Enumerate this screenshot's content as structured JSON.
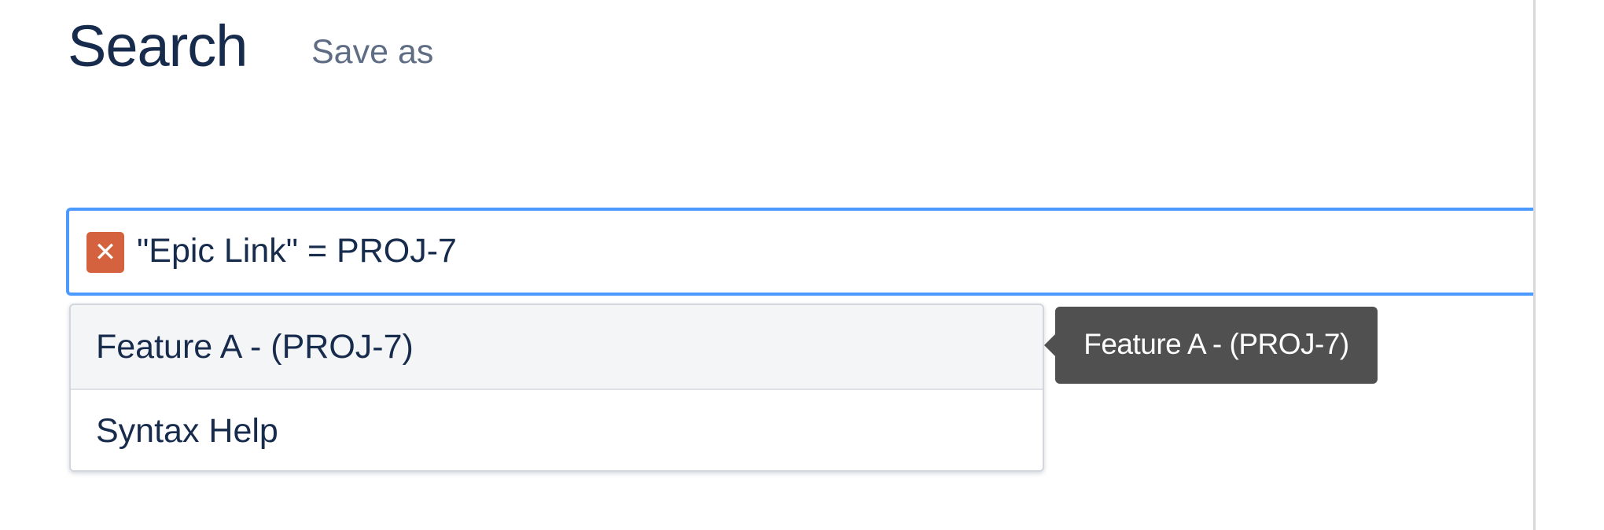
{
  "header": {
    "title": "Search",
    "save_as_label": "Save as"
  },
  "search": {
    "query": "\"Epic Link\" = PROJ-7",
    "error_icon": "close-x-icon",
    "error_icon_glyph": "✕"
  },
  "suggestions": {
    "items": [
      {
        "label": "Feature A - (PROJ-7)"
      },
      {
        "label": "Syntax Help"
      }
    ]
  },
  "tooltip": {
    "text": "Feature A - (PROJ-7)"
  },
  "colors": {
    "title": "#172b4d",
    "focus_border": "#4c9aff",
    "error_icon_bg": "#d4623f",
    "tooltip_bg": "#505050"
  }
}
